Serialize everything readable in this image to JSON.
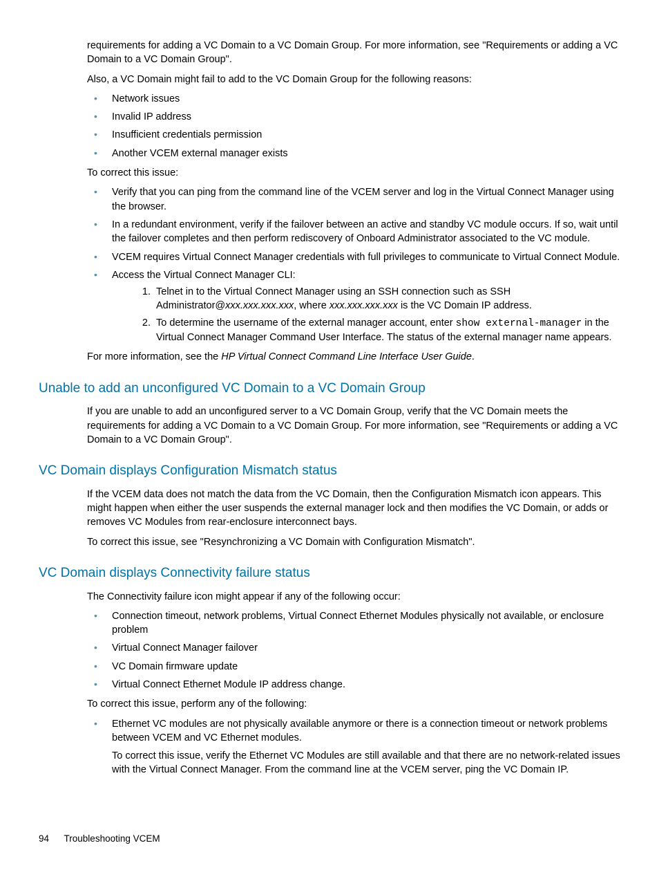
{
  "intro_p1": "requirements for adding a VC Domain to a VC Domain Group. For more information, see \"Requirements or adding a VC Domain to a VC Domain Group\".",
  "intro_p2": "Also, a VC Domain might fail to add to the VC Domain Group for the following reasons:",
  "reasons": [
    "Network issues",
    "Invalid IP address",
    "Insufficient credentials permission",
    "Another VCEM external manager exists"
  ],
  "correct_intro": "To correct this issue:",
  "corrections": {
    "item1": "Verify that you can ping from the command line of the VCEM server and log in the Virtual Connect Manager using the browser.",
    "item2": "In a redundant environment, verify if the failover between an active and standby VC module occurs. If so, wait until the failover completes and then perform rediscovery of Onboard Administrator associated to the VC module.",
    "item3": "VCEM requires Virtual Connect Manager credentials with full privileges to communicate to Virtual Connect Module.",
    "item4_lead": "Access the Virtual Connect Manager CLI:",
    "ol1_a": "Telnet in to the Virtual Connect Manager using an SSH connection such as SSH Administrator@",
    "ol1_b": "xxx.xxx.xxx.xxx",
    "ol1_c": ", where ",
    "ol1_d": "xxx.xxx.xxx.xxx",
    "ol1_e": " is the VC Domain IP address.",
    "ol2_a": "To determine the username of the external manager account, enter ",
    "ol2_code": "show external-manager",
    "ol2_b": " in the Virtual Connect Manager Command User Interface. The status of the external manager name appears."
  },
  "more_info_a": "For more information, see the ",
  "more_info_b": "HP Virtual Connect Command Line Interface User Guide",
  "more_info_c": ".",
  "sec1_title": "Unable to add an unconfigured VC Domain to a VC Domain Group",
  "sec1_body": "If you are unable to add an unconfigured server to a VC Domain Group, verify that the VC Domain meets the requirements for adding a VC Domain to a VC Domain Group. For more information, see \"Requirements or adding a VC Domain to a VC Domain Group\".",
  "sec2_title": "VC Domain displays Configuration Mismatch status",
  "sec2_p1": "If the VCEM data does not match the data from the VC Domain, then the Configuration Mismatch icon appears. This might happen when either the user suspends the external manager lock and then modifies the VC Domain, or adds or removes VC Modules from rear-enclosure interconnect bays.",
  "sec2_p2": "To correct this issue, see \"Resynchronizing a VC Domain with Configuration Mismatch\".",
  "sec3_title": "VC Domain displays Connectivity failure status",
  "sec3_p1": "The Connectivity failure icon might appear if any of the following occur:",
  "sec3_reasons": [
    "Connection timeout, network problems, Virtual Connect Ethernet Modules physically not available, or enclosure problem",
    "Virtual Connect Manager failover",
    "VC Domain firmware update",
    "Virtual Connect Ethernet Module IP address change."
  ],
  "sec3_p2": "To correct this issue, perform any of the following:",
  "sec3_fix1": "Ethernet VC modules are not physically available anymore or there is a connection timeout or network problems between VCEM and VC Ethernet modules.",
  "sec3_fix1_sub": "To correct this issue, verify the Ethernet VC Modules are still available and that there are no network-related issues with the Virtual Connect Manager. From the command line at the VCEM server, ping the VC Domain IP.",
  "footer_page": "94",
  "footer_label": "Troubleshooting VCEM"
}
